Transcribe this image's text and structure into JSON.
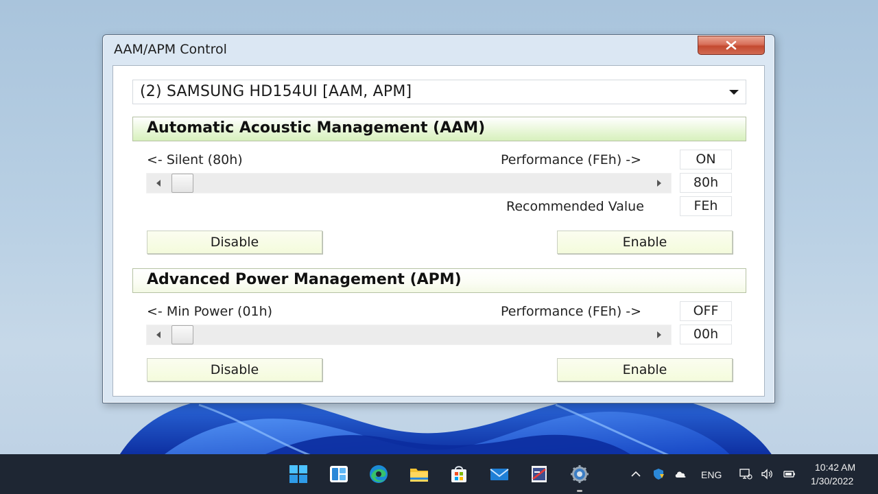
{
  "window": {
    "title": "AAM/APM Control",
    "close_label": "close"
  },
  "drive_select": {
    "selected": "(2) SAMSUNG HD154UI [AAM, APM]"
  },
  "aam": {
    "header": "Automatic Acoustic Management (AAM)",
    "left_label": "<- Silent (80h)",
    "right_label": "Performance (FEh) ->",
    "status": "ON",
    "current_value": "80h",
    "recommended_label": "Recommended Value",
    "recommended_value": "FEh",
    "slider_position": 0.0,
    "disable_label": "Disable",
    "enable_label": "Enable"
  },
  "apm": {
    "header": "Advanced Power Management (APM)",
    "left_label": "<- Min Power (01h)",
    "right_label": "Performance (FEh) ->",
    "status": "OFF",
    "current_value": "00h",
    "slider_position": 0.0,
    "disable_label": "Disable",
    "enable_label": "Enable"
  },
  "taskbar": {
    "apps": [
      "start-icon",
      "widgets-icon",
      "edge-icon",
      "file-explorer-icon",
      "store-icon",
      "mail-icon",
      "app-icon",
      "settings-icon"
    ],
    "tray": {
      "language": "ENG",
      "time": "10:42 AM",
      "date": "1/30/2022"
    }
  },
  "colors": {
    "aam_header_bg": "#d7f0bd",
    "button_bg": "#f4fbdc",
    "taskbar_bg": "#1e2633"
  }
}
